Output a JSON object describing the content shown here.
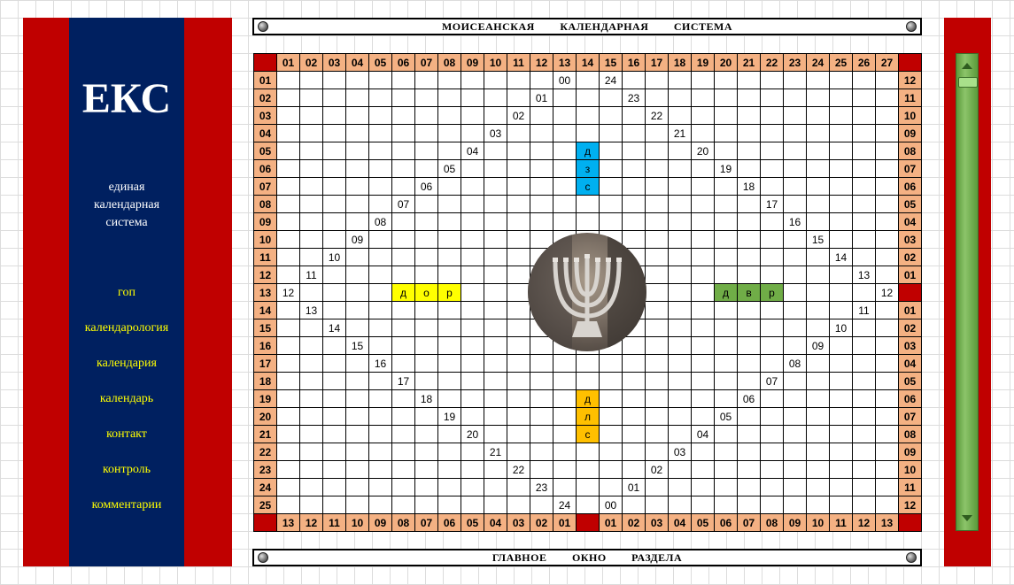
{
  "sidebar": {
    "logo": "ЕКС",
    "tagline": [
      "единая",
      "календарная",
      "система"
    ],
    "menu": [
      "гоп",
      "календарология",
      "календария",
      "календарь",
      "контакт",
      "контроль",
      "комментарии"
    ]
  },
  "header": {
    "title": "МОИСЕАНСКАЯ   КАЛЕНДАРНАЯ   СИСТЕМА"
  },
  "footer": {
    "title": "ГЛАВНОЕ   ОКНО   РАЗДЕЛА"
  },
  "grid": {
    "top_header": [
      "01",
      "02",
      "03",
      "04",
      "05",
      "06",
      "07",
      "08",
      "09",
      "10",
      "11",
      "12",
      "13",
      "14",
      "15",
      "16",
      "17",
      "18",
      "19",
      "20",
      "21",
      "22",
      "23",
      "24",
      "25",
      "26",
      "27"
    ],
    "bottom_header": [
      "13",
      "12",
      "11",
      "10",
      "09",
      "08",
      "07",
      "06",
      "05",
      "04",
      "03",
      "02",
      "01",
      "",
      "01",
      "02",
      "03",
      "04",
      "05",
      "06",
      "07",
      "08",
      "09",
      "10",
      "11",
      "12",
      "13"
    ],
    "left_labels": [
      "01",
      "02",
      "03",
      "04",
      "05",
      "06",
      "07",
      "08",
      "09",
      "10",
      "11",
      "12",
      "13",
      "14",
      "15",
      "16",
      "17",
      "18",
      "19",
      "20",
      "21",
      "22",
      "23",
      "24",
      "25"
    ],
    "right_labels": [
      "12",
      "11",
      "10",
      "09",
      "08",
      "07",
      "06",
      "05",
      "04",
      "03",
      "02",
      "01",
      "",
      "01",
      "02",
      "03",
      "04",
      "05",
      "06",
      "07",
      "08",
      "09",
      "10",
      "11",
      "12"
    ],
    "cells": [
      [
        "01",
        13,
        "00"
      ],
      [
        "01",
        15,
        "24"
      ],
      [
        "02",
        12,
        "01"
      ],
      [
        "02",
        16,
        "23"
      ],
      [
        "03",
        11,
        "02"
      ],
      [
        "03",
        17,
        "22"
      ],
      [
        "04",
        10,
        "03"
      ],
      [
        "04",
        18,
        "21"
      ],
      [
        "05",
        9,
        "04"
      ],
      [
        "05",
        19,
        "20"
      ],
      [
        "06",
        8,
        "05"
      ],
      [
        "06",
        20,
        "19"
      ],
      [
        "07",
        7,
        "06"
      ],
      [
        "07",
        21,
        "18"
      ],
      [
        "08",
        6,
        "07"
      ],
      [
        "08",
        22,
        "17"
      ],
      [
        "09",
        5,
        "08"
      ],
      [
        "09",
        23,
        "16"
      ],
      [
        "10",
        4,
        "09"
      ],
      [
        "10",
        24,
        "15"
      ],
      [
        "11",
        3,
        "10"
      ],
      [
        "11",
        25,
        "14"
      ],
      [
        "12",
        2,
        "11"
      ],
      [
        "12",
        26,
        "13"
      ],
      [
        "13",
        1,
        "12"
      ],
      [
        "13",
        27,
        "12"
      ],
      [
        "14",
        2,
        "13"
      ],
      [
        "14",
        26,
        "11"
      ],
      [
        "15",
        3,
        "14"
      ],
      [
        "15",
        25,
        "10"
      ],
      [
        "16",
        4,
        "15"
      ],
      [
        "16",
        24,
        "09"
      ],
      [
        "17",
        5,
        "16"
      ],
      [
        "17",
        23,
        "08"
      ],
      [
        "18",
        6,
        "17"
      ],
      [
        "18",
        22,
        "07"
      ],
      [
        "19",
        7,
        "18"
      ],
      [
        "19",
        21,
        "06"
      ],
      [
        "20",
        8,
        "19"
      ],
      [
        "20",
        20,
        "05"
      ],
      [
        "21",
        9,
        "20"
      ],
      [
        "21",
        19,
        "04"
      ],
      [
        "22",
        10,
        "21"
      ],
      [
        "22",
        18,
        "03"
      ],
      [
        "23",
        11,
        "22"
      ],
      [
        "23",
        17,
        "02"
      ],
      [
        "24",
        12,
        "23"
      ],
      [
        "24",
        16,
        "01"
      ],
      [
        "25",
        13,
        "24"
      ],
      [
        "25",
        15,
        "00"
      ]
    ],
    "colored_blocks": {
      "top": [
        "д",
        "з",
        "с"
      ],
      "left": [
        "д",
        "о",
        "р"
      ],
      "right": [
        "д",
        "в",
        "р"
      ],
      "bottom": [
        "д",
        "л",
        "с"
      ]
    },
    "colors": {
      "blue": "#00b0f0",
      "yellow": "#ffff00",
      "green": "#70ad47",
      "orange": "#ffc000",
      "header": "#f4b183",
      "corner": "#c00000"
    },
    "center_image": "menorah-photo"
  }
}
